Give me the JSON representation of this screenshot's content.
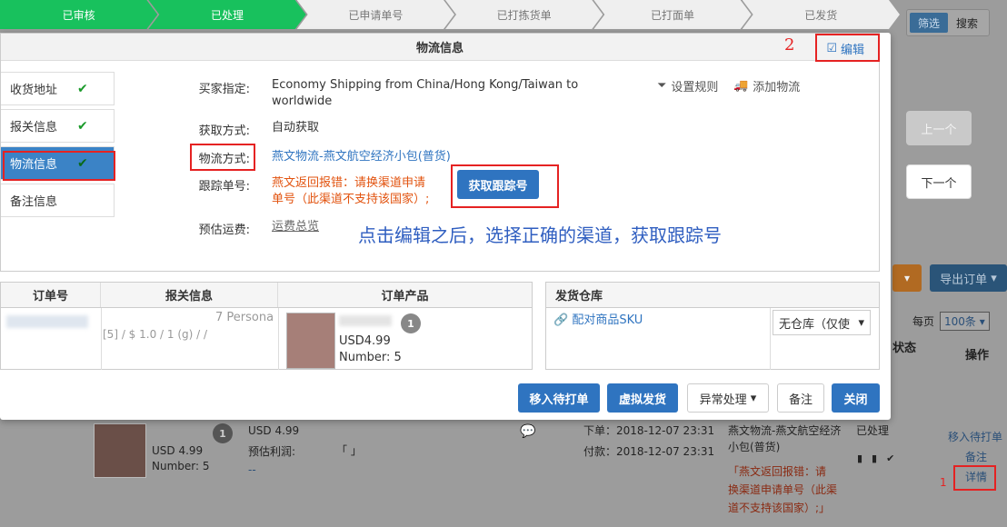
{
  "steps": [
    "已审核",
    "已处理",
    "已申请单号",
    "已打拣货单",
    "已打面单",
    "已发货"
  ],
  "modal": {
    "title": "物流信息",
    "edit_label": "编辑",
    "annotation_2": "2",
    "tabs": [
      {
        "label": "收货地址"
      },
      {
        "label": "报关信息"
      },
      {
        "label": "物流信息"
      },
      {
        "label": "备注信息"
      }
    ],
    "check": "✔",
    "fields": {
      "buyer_label": "买家指定:",
      "buyer_value_1": "Economy Shipping from China/Hong Kong/Taiwan to",
      "buyer_value_2": "worldwide",
      "acquire_label": "获取方式:",
      "acquire_value": "自动获取",
      "method_label": "物流方式:",
      "method_value": "燕文物流-燕文航空经济小包(普货)",
      "tracking_label": "跟踪单号:",
      "tracking_error_1": "燕文返回报错：请换渠道申请",
      "tracking_error_2": "单号（此渠道不支持该国家）;",
      "get_tracking": "获取跟踪号",
      "fee_label": "预估运费:",
      "fee_value": "运费总览"
    },
    "set_rule": "设置规则",
    "add_logistics": "添加物流",
    "hint": "点击编辑之后，选择正确的渠道，获取跟踪号",
    "order_table": {
      "headers": [
        "订单号",
        "报关信息",
        "订单产品"
      ],
      "customs": "7 Persona",
      "customs_line": "[5] / $ 1.0 / 1 (g) / /",
      "price": "USD4.99",
      "number": "Number: 5",
      "badge": "1"
    },
    "warehouse": {
      "header": "发货仓库",
      "sku_link": "配对商品SKU",
      "select": "无仓库（仅使"
    },
    "buttons": {
      "move": "移入待打单",
      "virtual": "虚拟发货",
      "exception": "异常处理",
      "note": "备注",
      "close": "关闭"
    }
  },
  "background": {
    "filter": "筛选",
    "search": "搜索",
    "prev": "上一个",
    "next": "下一个",
    "export": "导出订单",
    "per_page_label": "每页",
    "per_page_value": "100条",
    "status_head": "状态",
    "action_head": "操作",
    "row": {
      "usd1": "USD 4.99",
      "usd2": "USD 4.99",
      "number": "Number: 5",
      "badge": "1",
      "profit": "预估利润:",
      "dash": "--",
      "bracket": "「  」",
      "order_time": "下单：2018-12-07 23:31",
      "pay_time": "付款：2018-12-07 23:31",
      "logistics": "燕文物流-燕文航空经济小包(普货)",
      "err1": "「燕文返回报错：请",
      "err2": "换渠道申请单号（此渠",
      "err3": "道不支持该国家）;」",
      "status": "已处理",
      "act1": "移入待打单",
      "act2": "备注",
      "act3": "详情",
      "anno1": "1"
    }
  }
}
